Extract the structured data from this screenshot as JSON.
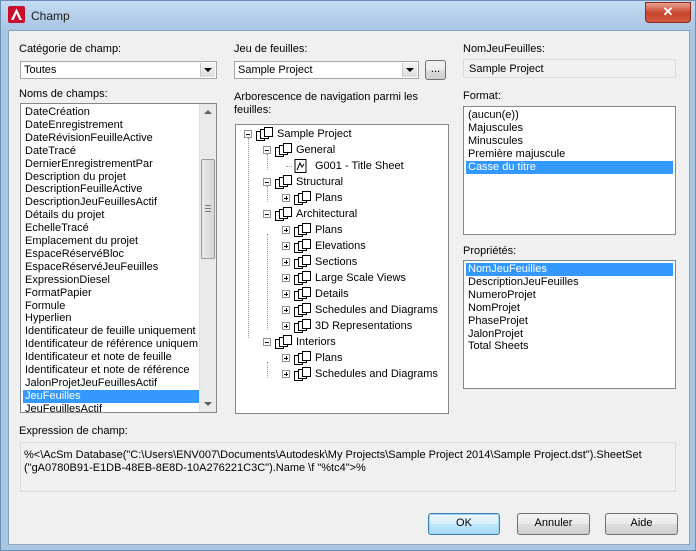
{
  "window": {
    "title": "Champ",
    "close_label": "✕"
  },
  "left": {
    "category_label": "Catégorie de champ:",
    "category_value": "Toutes",
    "names_label": "Noms de champs:",
    "names": [
      "DateCréation",
      "DateEnregistrement",
      "DateRévisionFeuilleActive",
      "DateTracé",
      "DernierEnregistrementPar",
      "Description du projet",
      "DescriptionFeuilleActive",
      "DescriptionJeuFeuillesActif",
      "Détails du projet",
      "EchelleTracé",
      "Emplacement du projet",
      "EspaceRéservéBloc",
      "EspaceRéservéJeuFeuilles",
      "ExpressionDiesel",
      "FormatPapier",
      "Formule",
      "Hyperlien",
      "Identificateur de feuille uniquement",
      "Identificateur de référence uniquem",
      "Identificateur et note de feuille",
      "Identificateur et note de référence",
      "JalonProjetJeuFeuillesActif",
      "JeuFeuilles",
      "JeuFeuillesActif"
    ],
    "selected_index": 22
  },
  "middle": {
    "sheetset_label": "Jeu de feuilles:",
    "sheetset_value": "Sample Project",
    "browse_label": "...",
    "tree_label": "Arborescence de navigation parmi les feuilles:",
    "tree": [
      {
        "label": "Sample Project",
        "level": 0,
        "expander": "minus"
      },
      {
        "label": "General",
        "level": 1,
        "expander": "minus"
      },
      {
        "label": "G001 - Title Sheet",
        "level": 2,
        "expander": "",
        "sheet": true
      },
      {
        "label": "Structural",
        "level": 1,
        "expander": "minus"
      },
      {
        "label": "Plans",
        "level": 2,
        "expander": "plus"
      },
      {
        "label": "Architectural",
        "level": 1,
        "expander": "minus"
      },
      {
        "label": "Plans",
        "level": 2,
        "expander": "plus"
      },
      {
        "label": "Elevations",
        "level": 2,
        "expander": "plus"
      },
      {
        "label": "Sections",
        "level": 2,
        "expander": "plus"
      },
      {
        "label": "Large Scale Views",
        "level": 2,
        "expander": "plus"
      },
      {
        "label": "Details",
        "level": 2,
        "expander": "plus"
      },
      {
        "label": "Schedules and Diagrams",
        "level": 2,
        "expander": "plus"
      },
      {
        "label": "3D Representations",
        "level": 2,
        "expander": "plus"
      },
      {
        "label": "Interiors",
        "level": 1,
        "expander": "minus"
      },
      {
        "label": "Plans",
        "level": 2,
        "expander": "plus"
      },
      {
        "label": "Schedules and Diagrams",
        "level": 2,
        "expander": "plus"
      }
    ]
  },
  "right": {
    "name_label": "NomJeuFeuilles:",
    "name_value": "Sample Project",
    "format_label": "Format:",
    "formats": [
      "(aucun(e))",
      "Majuscules",
      "Minuscules",
      "Première majuscule",
      "Casse du titre"
    ],
    "format_selected": 4,
    "props_label": "Propriétés:",
    "props": [
      "NomJeuFeuilles",
      "DescriptionJeuFeuilles",
      "NumeroProjet",
      "NomProjet",
      "PhaseProjet",
      "JalonProjet",
      "Total Sheets"
    ],
    "props_selected": 0
  },
  "expression": {
    "label": "Expression de champ:",
    "line1": "%<\\AcSm Database(\"C:\\Users\\ENV007\\Documents\\Autodesk\\My Projects\\Sample Project 2014\\Sample Project.dst\").SheetSet",
    "line2": "(\"gA0780B91-E1DB-48EB-8E8D-10A276221C3C\").Name \\f \"%tc4\">%"
  },
  "buttons": {
    "ok": "OK",
    "cancel": "Annuler",
    "help": "Aide"
  },
  "colors": {
    "selection": "#3399ff",
    "frame": "#a9c6e4"
  },
  "icons": {
    "app": "autocad-icon",
    "sheet_set": "sheet-set-icon",
    "sheet": "sheet-icon"
  }
}
